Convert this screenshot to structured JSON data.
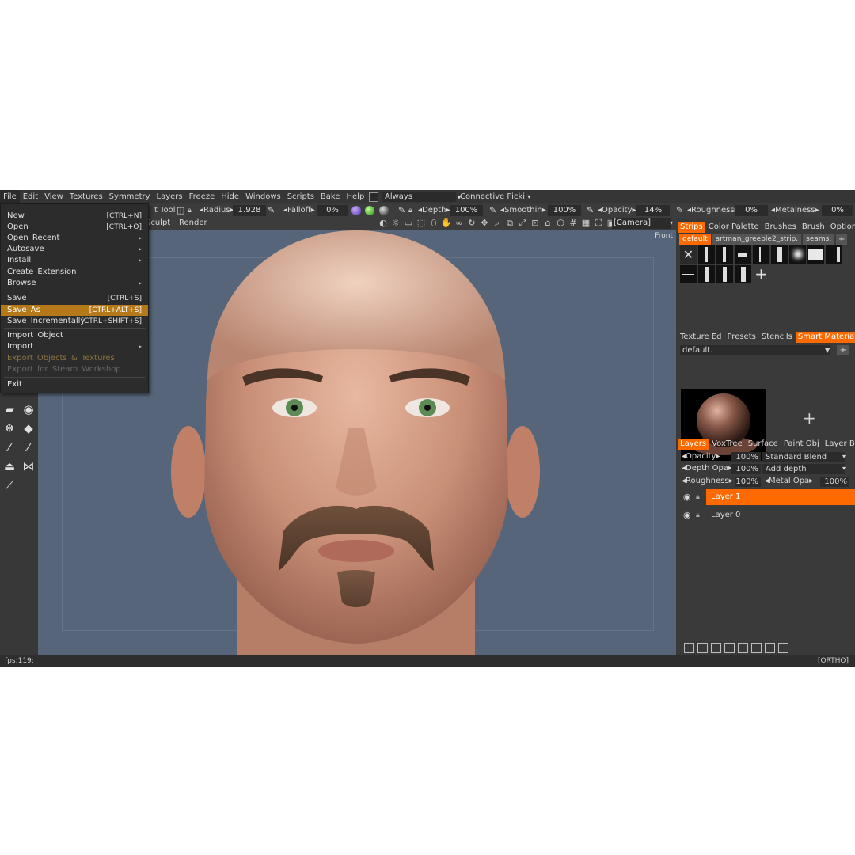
{
  "menubar": {
    "items": [
      "File",
      "Edit",
      "View",
      "Textures",
      "Symmetry",
      "Layers",
      "Freeze",
      "Hide",
      "Windows",
      "Scripts",
      "Bake",
      "Help"
    ],
    "always_label": "Always",
    "connective_label": "Connective Picki"
  },
  "file_menu": {
    "items": [
      {
        "label": "New",
        "shortcut": "[CTRL+N]"
      },
      {
        "label": "Open",
        "shortcut": "[CTRL+O]"
      },
      {
        "label": "Open Recent",
        "arrow": "▸"
      },
      {
        "label": "Autosave",
        "arrow": "▸"
      },
      {
        "label": "Install",
        "arrow": "▸"
      },
      {
        "label": "Create Extension"
      },
      {
        "label": "Browse",
        "arrow": "▸"
      },
      {
        "label": "Save",
        "shortcut": "[CTRL+S]"
      },
      {
        "label": "Save As",
        "shortcut": "[CTRL+ALT+S]"
      },
      {
        "label": "Save Incrementally",
        "shortcut": "[CTRL+SHIFT+S]"
      },
      {
        "label": "Import Object"
      },
      {
        "label": "Import",
        "arrow": "▸"
      },
      {
        "label": "Export Objects & Textures"
      },
      {
        "label": "Export for Steam Workshop"
      },
      {
        "label": "Exit"
      }
    ]
  },
  "toolbar": {
    "tool_label": "t Tool",
    "sculpt_label": "Sculpt",
    "render_label": "Render",
    "radius_label": "Radius",
    "radius_value": "1.928",
    "falloff_label": "Falloff",
    "falloff_value": "0%",
    "depth_label": "Depth",
    "depth_value": "100%",
    "smoothing_label": "Smoothin",
    "smoothing_value": "100%",
    "opacity_label": "Opacity",
    "opacity_value": "14%",
    "roughness_label": "Roughness",
    "roughness_value": "0%",
    "metalness_label": "Metalness",
    "metalness_value": "0%",
    "camera_label": "[Camera]"
  },
  "viewport": {
    "view_label": "Front"
  },
  "status": {
    "fps": "fps:119;",
    "mode": "[ORTHO]"
  },
  "right_panel": {
    "strips_tabs": [
      "Strips",
      "Color Palette",
      "Brushes",
      "Brush",
      "Option"
    ],
    "strips_chips": [
      "default",
      "artman_greeble2_strip.",
      "seams."
    ],
    "materials_tabs": [
      "Texture Ed",
      "Presets",
      "Stencils",
      "Smart Materials"
    ],
    "materials_select": "default.",
    "layers_tabs": [
      "Layers",
      "VoxTree",
      "Surface",
      "Paint Obj",
      "Layer Bl"
    ],
    "layer_props": {
      "opacity_label": "Opacity",
      "opacity_value": "100%",
      "blend_mode": "Standard Blend",
      "depth_label": "Depth Opa",
      "depth_value": "100%",
      "depth_mode": "Add depth",
      "roughness_label": "Roughness",
      "roughness_value": "100%",
      "metal_label": "Metal Opa",
      "metal_value": "100%"
    },
    "layers": [
      {
        "name": "Layer 1",
        "active": true
      },
      {
        "name": "Layer 0",
        "active": false
      }
    ]
  },
  "colors": {
    "accent": "#ff6a00",
    "menu_highlight": "#b5791a",
    "viewport_bg": "#56657a"
  }
}
